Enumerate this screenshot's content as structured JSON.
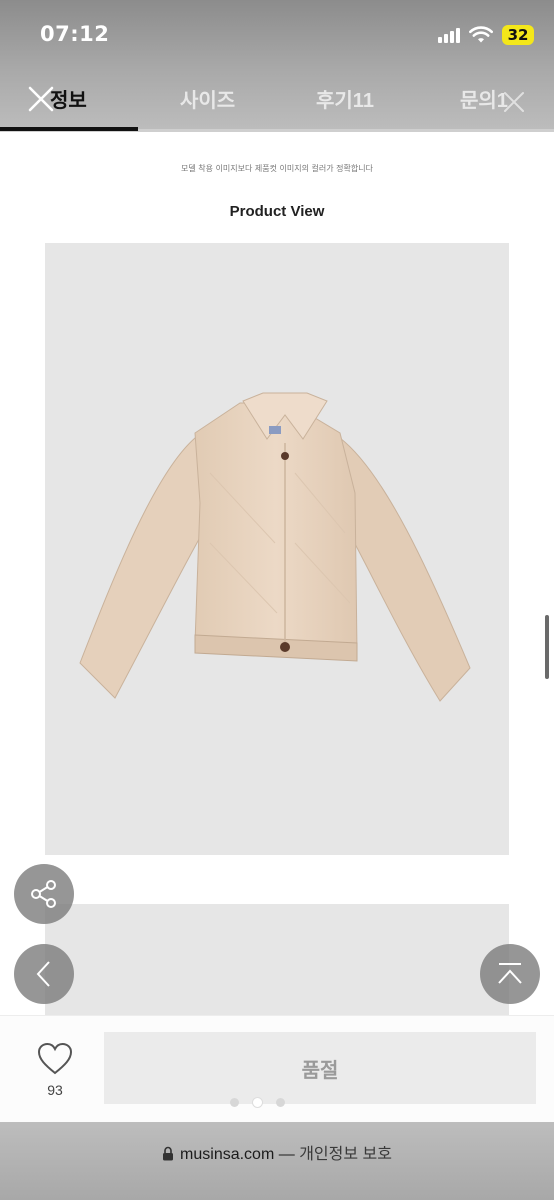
{
  "status_bar": {
    "time": "07:12",
    "battery": "32",
    "icons": [
      "signal-icon",
      "wifi-icon",
      "battery-icon"
    ]
  },
  "tabs": [
    {
      "label": "정보",
      "active": true
    },
    {
      "label": "사이즈",
      "active": false
    },
    {
      "label": "후기11",
      "active": false
    },
    {
      "label": "문의1",
      "active": false
    }
  ],
  "content": {
    "caption": "모델 착용 이미지보다 제품컷 이미지의 컬러가 정확합니다",
    "section_title": "Product View"
  },
  "floating_buttons": [
    "share-icon",
    "chevron-left-icon",
    "scroll-top-icon"
  ],
  "bottom_bar": {
    "like_count": "93",
    "buy_button_label": "품절",
    "page_dots": 3,
    "active_dot": 2
  },
  "browser": {
    "domain": "musinsa.com",
    "separator": "—",
    "privacy_label": "개인정보 보호"
  },
  "colors": {
    "header_grey": "#a9a9a9",
    "battery": "#f4e71a",
    "image_background": "#e6e6e6",
    "jacket": "#e9d6c2",
    "soldout_button": "#ebebeb"
  }
}
